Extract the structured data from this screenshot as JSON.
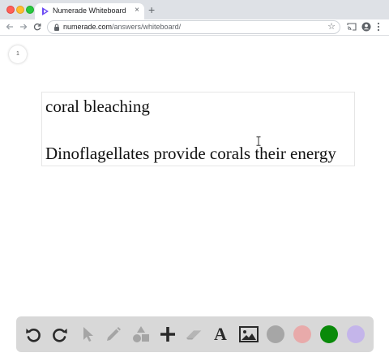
{
  "browser": {
    "tab_title": "Numerade Whiteboard",
    "tab_close": "×",
    "new_tab": "+",
    "url_host": "numerade.com",
    "url_path": "/answers/whiteboard/",
    "icons": {
      "back": "arrow-left-icon",
      "forward": "arrow-right-icon",
      "reload": "reload-icon",
      "lock": "lock-icon",
      "star": "star-icon",
      "cast": "cast-icon",
      "account": "account-icon",
      "menu": "kebab-menu-icon"
    },
    "colors": {
      "favicon": "#6c4bf4",
      "tab_strip": "#dee1e6"
    }
  },
  "whiteboard": {
    "page_number": "1",
    "text_lines": [
      "coral bleaching",
      "Dinoflagellates provide corals their energy"
    ]
  },
  "toolbar": {
    "tools": [
      {
        "name": "undo",
        "icon": "undo-icon",
        "enabled": true
      },
      {
        "name": "redo",
        "icon": "redo-icon",
        "enabled": true
      },
      {
        "name": "select",
        "icon": "cursor-icon",
        "enabled": false
      },
      {
        "name": "pen",
        "icon": "pencil-icon",
        "enabled": false
      },
      {
        "name": "shapes",
        "icon": "shapes-icon",
        "enabled": false
      },
      {
        "name": "add",
        "icon": "plus-icon",
        "enabled": true
      },
      {
        "name": "eraser",
        "icon": "eraser-icon",
        "enabled": false
      },
      {
        "name": "text",
        "icon": "text-icon",
        "label": "A",
        "enabled": true
      },
      {
        "name": "image",
        "icon": "image-icon",
        "enabled": true
      }
    ],
    "swatches": [
      "#a6a6a6",
      "#e8aaaa",
      "#0a8a0a",
      "#c4b5ea"
    ]
  }
}
